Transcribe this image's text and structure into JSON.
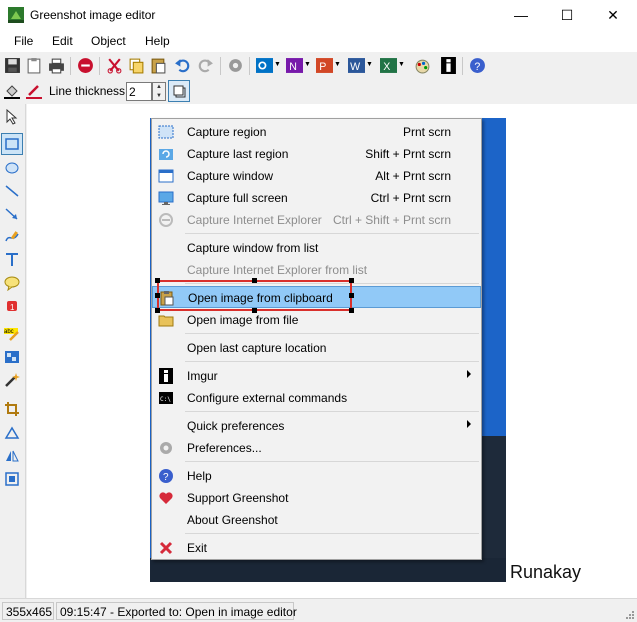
{
  "window": {
    "title": "Greenshot image editor",
    "controls": {
      "minimize": "—",
      "maximize": "☐",
      "close": "✕"
    }
  },
  "menubar": {
    "items": [
      "File",
      "Edit",
      "Object",
      "Help"
    ]
  },
  "toolbar": {
    "icons": [
      "save-icon",
      "clipboard-icon",
      "print-icon",
      "delete-icon",
      "cut-icon",
      "copy-icon",
      "paste-icon",
      "undo-icon",
      "redo-icon",
      "settings-icon",
      "outlook-icon",
      "onenote-icon",
      "powerpoint-icon",
      "word-icon",
      "excel-icon",
      "paint-icon",
      "imgur-icon",
      "help-icon"
    ]
  },
  "properties": {
    "line_thickness_label": "Line thickness",
    "line_thickness_value": "2"
  },
  "sidebar": {
    "tools": [
      "pointer-tool-icon",
      "rectangle-tool-icon",
      "ellipse-tool-icon",
      "line-tool-icon",
      "arrow-tool-icon",
      "freehand-tool-icon",
      "text-tool-icon",
      "speechbubble-tool-icon",
      "counter-tool-icon",
      "highlight-tool-icon",
      "obfuscate-tool-icon",
      "magic-tool-icon",
      "crop-tool-icon",
      "rotate-tool-icon",
      "flip-tool-icon",
      "resize-tool-icon"
    ]
  },
  "context_menu": {
    "items": [
      {
        "label": "Capture region",
        "shortcut": "Prnt scrn",
        "icon": "region-icon",
        "disabled": false
      },
      {
        "label": "Capture last region",
        "shortcut": "Shift + Prnt scrn",
        "icon": "last-region-icon",
        "disabled": false
      },
      {
        "label": "Capture window",
        "shortcut": "Alt + Prnt scrn",
        "icon": "window-icon",
        "disabled": false
      },
      {
        "label": "Capture full screen",
        "shortcut": "Ctrl + Prnt scrn",
        "icon": "fullscreen-icon",
        "disabled": false
      },
      {
        "label": "Capture Internet Explorer",
        "shortcut": "Ctrl + Shift + Prnt scrn",
        "icon": "ie-icon",
        "disabled": true
      },
      {
        "label": "Capture window from list",
        "shortcut": "",
        "icon": "",
        "disabled": false
      },
      {
        "label": "Capture Internet Explorer from list",
        "shortcut": "",
        "icon": "",
        "disabled": true
      },
      {
        "label": "Open image from clipboard",
        "shortcut": "",
        "icon": "clipboard-icon",
        "disabled": false,
        "highlighted": true
      },
      {
        "label": "Open image from file",
        "shortcut": "",
        "icon": "folder-icon",
        "disabled": false
      },
      {
        "label": "Open last capture location",
        "shortcut": "",
        "icon": "",
        "disabled": false
      },
      {
        "label": "Imgur",
        "shortcut": "",
        "icon": "imgur-icon",
        "disabled": false,
        "submenu": true
      },
      {
        "label": "Configure external commands",
        "shortcut": "",
        "icon": "cmd-icon",
        "disabled": false
      },
      {
        "label": "Quick preferences",
        "shortcut": "",
        "icon": "",
        "disabled": false,
        "submenu": true
      },
      {
        "label": "Preferences...",
        "shortcut": "",
        "icon": "gear-icon",
        "disabled": false
      },
      {
        "label": "Help",
        "shortcut": "",
        "icon": "help-icon",
        "disabled": false
      },
      {
        "label": "Support Greenshot",
        "shortcut": "",
        "icon": "heart-icon",
        "disabled": false
      },
      {
        "label": "About Greenshot",
        "shortcut": "",
        "icon": "",
        "disabled": false
      },
      {
        "label": "Exit",
        "shortcut": "",
        "icon": "exit-icon",
        "disabled": false
      }
    ]
  },
  "canvas": {
    "signature": "Runakay"
  },
  "status": {
    "dimensions": "355x465",
    "message": "09:15:47 - Exported to: Open in image editor"
  },
  "colors": {
    "highlight": "#91c9f7",
    "annotation_red": "#d9302c",
    "captured_blue": "#1c64c8"
  }
}
